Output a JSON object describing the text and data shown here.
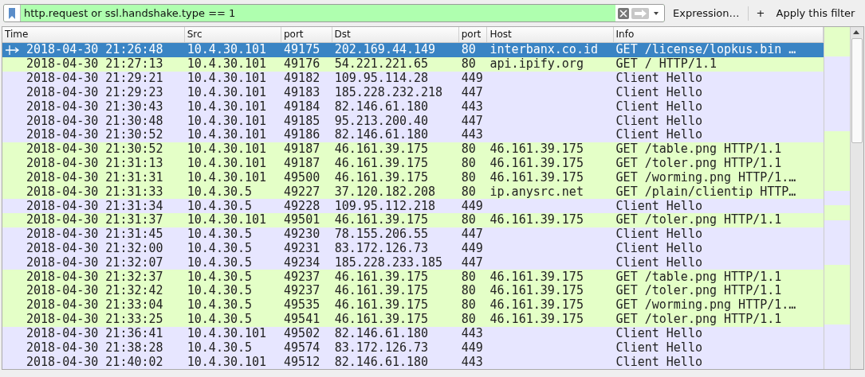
{
  "filter_bar": {
    "value": "http.request or ssl.handshake.type == 1",
    "valid": true,
    "expression_button": "Expression…",
    "add_button": "+",
    "apply_label": "Apply this filter"
  },
  "table": {
    "columns": [
      "Time",
      "Src",
      "port",
      "Dst",
      "port",
      "Host",
      "Info"
    ],
    "rows": [
      {
        "kind": "http",
        "selected": true,
        "cells": [
          "2018-04-30 21:26:48",
          "10.4.30.101",
          "49175",
          "202.169.44.149",
          "80",
          "interbanx.co.id",
          "GET /license/lopkus.bin …"
        ]
      },
      {
        "kind": "http",
        "selected": false,
        "cells": [
          "2018-04-30 21:27:13",
          "10.4.30.101",
          "49176",
          "54.221.221.65",
          "80",
          "api.ipify.org",
          "GET / HTTP/1.1"
        ]
      },
      {
        "kind": "tls",
        "selected": false,
        "cells": [
          "2018-04-30 21:29:21",
          "10.4.30.101",
          "49182",
          "109.95.114.28",
          "449",
          "",
          "Client Hello"
        ]
      },
      {
        "kind": "tls",
        "selected": false,
        "cells": [
          "2018-04-30 21:29:23",
          "10.4.30.101",
          "49183",
          "185.228.232.218",
          "447",
          "",
          "Client Hello"
        ]
      },
      {
        "kind": "tls",
        "selected": false,
        "cells": [
          "2018-04-30 21:30:43",
          "10.4.30.101",
          "49184",
          "82.146.61.180",
          "443",
          "",
          "Client Hello"
        ]
      },
      {
        "kind": "tls",
        "selected": false,
        "cells": [
          "2018-04-30 21:30:48",
          "10.4.30.101",
          "49185",
          "95.213.200.40",
          "447",
          "",
          "Client Hello"
        ]
      },
      {
        "kind": "tls",
        "selected": false,
        "cells": [
          "2018-04-30 21:30:52",
          "10.4.30.101",
          "49186",
          "82.146.61.180",
          "443",
          "",
          "Client Hello"
        ]
      },
      {
        "kind": "http",
        "selected": false,
        "cells": [
          "2018-04-30 21:30:52",
          "10.4.30.101",
          "49187",
          "46.161.39.175",
          "80",
          "46.161.39.175",
          "GET /table.png HTTP/1.1"
        ]
      },
      {
        "kind": "http",
        "selected": false,
        "cells": [
          "2018-04-30 21:31:13",
          "10.4.30.101",
          "49187",
          "46.161.39.175",
          "80",
          "46.161.39.175",
          "GET /toler.png HTTP/1.1"
        ]
      },
      {
        "kind": "http",
        "selected": false,
        "cells": [
          "2018-04-30 21:31:31",
          "10.4.30.101",
          "49500",
          "46.161.39.175",
          "80",
          "46.161.39.175",
          "GET /worming.png HTTP/1.…"
        ]
      },
      {
        "kind": "http",
        "selected": false,
        "cells": [
          "2018-04-30 21:31:33",
          "10.4.30.5",
          "49227",
          "37.120.182.208",
          "80",
          "ip.anysrc.net",
          "GET /plain/clientip HTTP…"
        ]
      },
      {
        "kind": "tls",
        "selected": false,
        "cells": [
          "2018-04-30 21:31:34",
          "10.4.30.5",
          "49228",
          "109.95.112.218",
          "449",
          "",
          "Client Hello"
        ]
      },
      {
        "kind": "http",
        "selected": false,
        "cells": [
          "2018-04-30 21:31:37",
          "10.4.30.101",
          "49501",
          "46.161.39.175",
          "80",
          "46.161.39.175",
          "GET /toler.png HTTP/1.1"
        ]
      },
      {
        "kind": "tls",
        "selected": false,
        "cells": [
          "2018-04-30 21:31:45",
          "10.4.30.5",
          "49230",
          "78.155.206.55",
          "447",
          "",
          "Client Hello"
        ]
      },
      {
        "kind": "tls",
        "selected": false,
        "cells": [
          "2018-04-30 21:32:00",
          "10.4.30.5",
          "49231",
          "83.172.126.73",
          "449",
          "",
          "Client Hello"
        ]
      },
      {
        "kind": "tls",
        "selected": false,
        "cells": [
          "2018-04-30 21:32:07",
          "10.4.30.5",
          "49234",
          "185.228.233.185",
          "447",
          "",
          "Client Hello"
        ]
      },
      {
        "kind": "http",
        "selected": false,
        "cells": [
          "2018-04-30 21:32:37",
          "10.4.30.5",
          "49237",
          "46.161.39.175",
          "80",
          "46.161.39.175",
          "GET /table.png HTTP/1.1"
        ]
      },
      {
        "kind": "http",
        "selected": false,
        "cells": [
          "2018-04-30 21:32:42",
          "10.4.30.5",
          "49237",
          "46.161.39.175",
          "80",
          "46.161.39.175",
          "GET /toler.png HTTP/1.1"
        ]
      },
      {
        "kind": "http",
        "selected": false,
        "cells": [
          "2018-04-30 21:33:04",
          "10.4.30.5",
          "49535",
          "46.161.39.175",
          "80",
          "46.161.39.175",
          "GET /worming.png HTTP/1.…"
        ]
      },
      {
        "kind": "http",
        "selected": false,
        "cells": [
          "2018-04-30 21:33:25",
          "10.4.30.5",
          "49541",
          "46.161.39.175",
          "80",
          "46.161.39.175",
          "GET /toler.png HTTP/1.1"
        ]
      },
      {
        "kind": "tls",
        "selected": false,
        "cells": [
          "2018-04-30 21:36:41",
          "10.4.30.101",
          "49502",
          "82.146.61.180",
          "443",
          "",
          "Client Hello"
        ]
      },
      {
        "kind": "tls",
        "selected": false,
        "cells": [
          "2018-04-30 21:38:28",
          "10.4.30.5",
          "49574",
          "83.172.126.73",
          "449",
          "",
          "Client Hello"
        ]
      },
      {
        "kind": "tls",
        "selected": false,
        "cells": [
          "2018-04-30 21:40:02",
          "10.4.30.101",
          "49512",
          "82.146.61.180",
          "443",
          "",
          "Client Hello"
        ]
      }
    ]
  }
}
